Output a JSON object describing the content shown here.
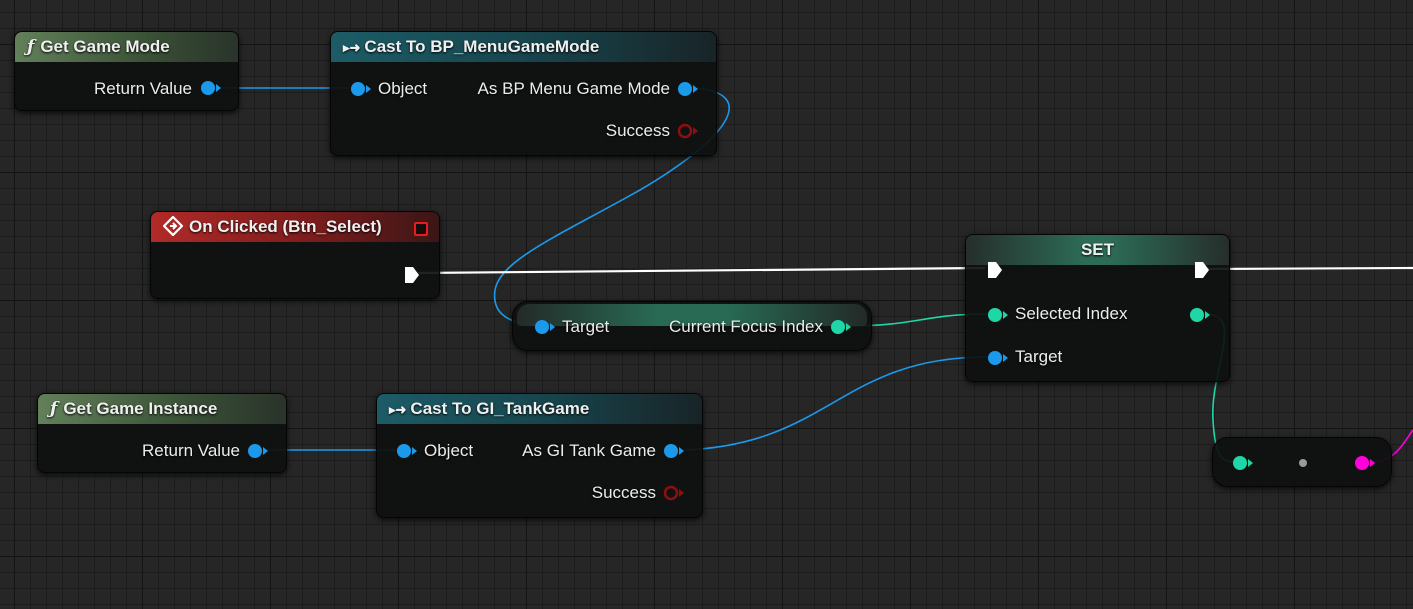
{
  "nodes": {
    "get_game_mode": {
      "title": "Get Game Mode",
      "return_label": "Return Value"
    },
    "cast_menu": {
      "title": "Cast To BP_MenuGameMode",
      "object_label": "Object",
      "as_label": "As BP Menu Game Mode",
      "success_label": "Success"
    },
    "on_clicked": {
      "title": "On Clicked (Btn_Select)"
    },
    "get_var": {
      "target_label": "Target",
      "value_label": "Current Focus Index"
    },
    "set": {
      "title": "SET",
      "selected_label": "Selected Index",
      "target_label": "Target"
    },
    "get_game_instance": {
      "title": "Get Game Instance",
      "return_label": "Return Value"
    },
    "cast_gi": {
      "title": "Cast To GI_TankGame",
      "object_label": "Object",
      "as_label": "As GI Tank Game",
      "success_label": "Success"
    }
  },
  "icons": {
    "function": "ƒ",
    "cast": "▸➜",
    "event": "diamond-arrow-icon"
  },
  "colors": {
    "object_pin": "#1b9aeb",
    "int_pin": "#1fd7a6",
    "exec": "#ffffff",
    "bool_pin": "#8e0f0f",
    "pink_pin": "#ff00dd"
  }
}
